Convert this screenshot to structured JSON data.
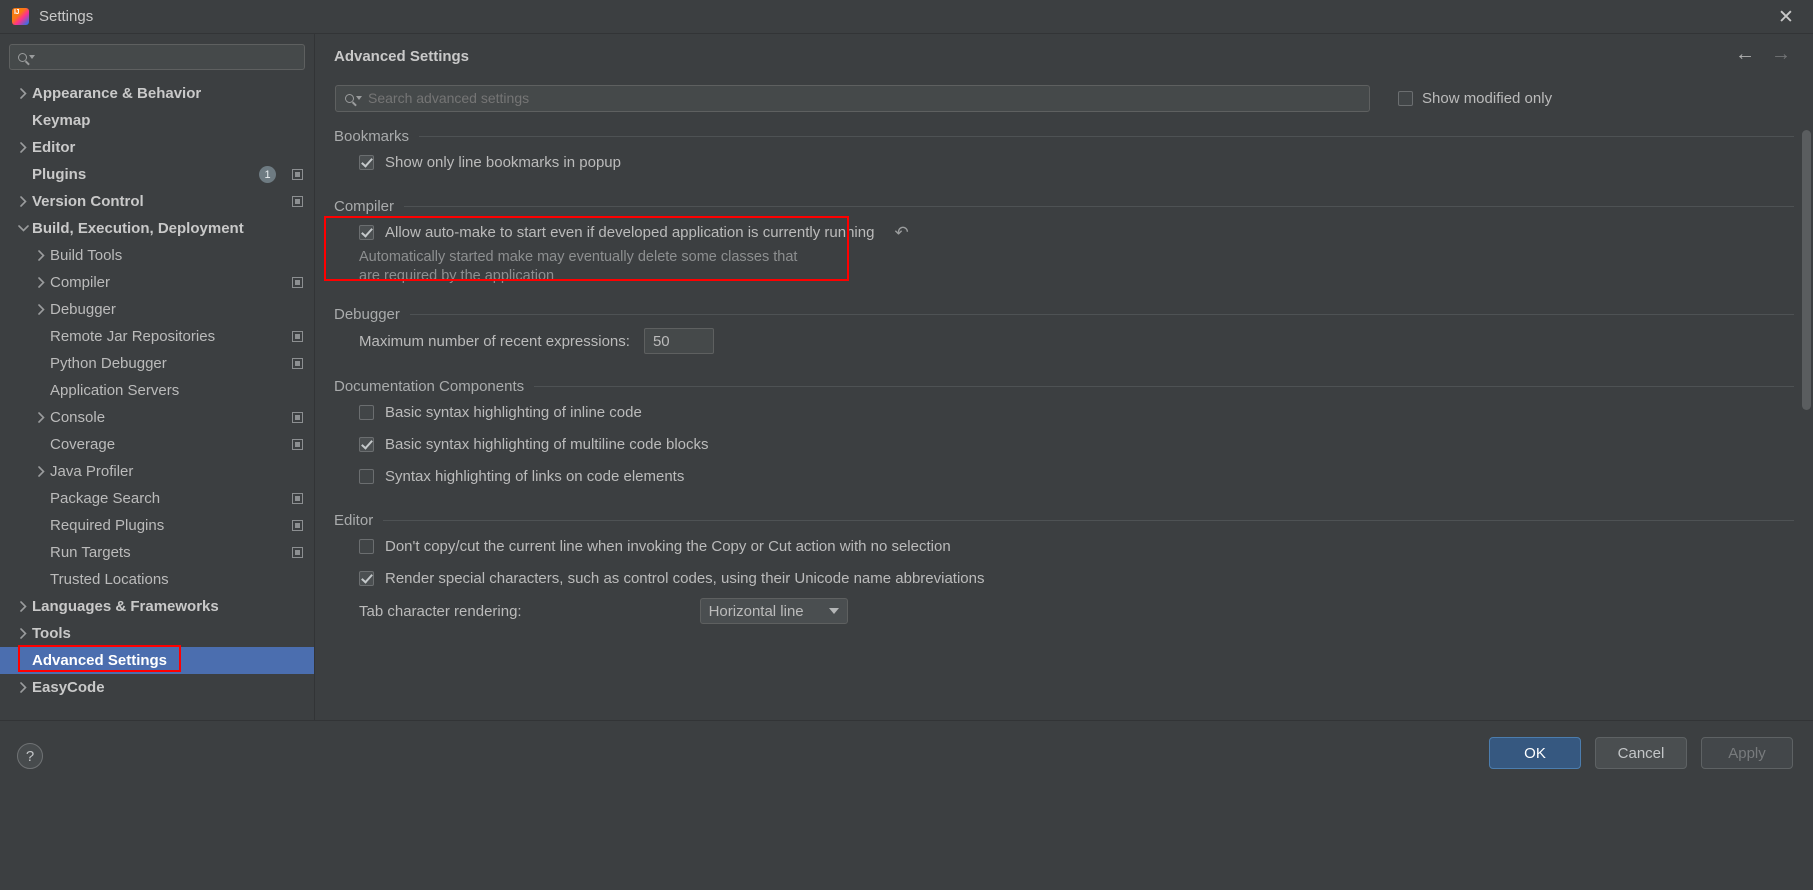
{
  "window": {
    "title": "Settings",
    "app_icon": "intellij-idea-icon",
    "close_label": "✕"
  },
  "sidebar": {
    "search": {
      "value": "",
      "placeholder": ""
    },
    "items": [
      {
        "label": "Appearance & Behavior",
        "chevron": "right",
        "indent": 0,
        "bold": true,
        "badge": null,
        "indicator": false,
        "selected": false
      },
      {
        "label": "Keymap",
        "chevron": "none",
        "indent": 0,
        "bold": true,
        "badge": null,
        "indicator": false,
        "selected": false
      },
      {
        "label": "Editor",
        "chevron": "right",
        "indent": 0,
        "bold": true,
        "badge": null,
        "indicator": false,
        "selected": false
      },
      {
        "label": "Plugins",
        "chevron": "none",
        "indent": 0,
        "bold": true,
        "badge": "1",
        "indicator": true,
        "selected": false
      },
      {
        "label": "Version Control",
        "chevron": "right",
        "indent": 0,
        "bold": true,
        "badge": null,
        "indicator": true,
        "selected": false
      },
      {
        "label": "Build, Execution, Deployment",
        "chevron": "down",
        "indent": 0,
        "bold": true,
        "badge": null,
        "indicator": false,
        "selected": false
      },
      {
        "label": "Build Tools",
        "chevron": "right",
        "indent": 1,
        "bold": false,
        "badge": null,
        "indicator": false,
        "selected": false
      },
      {
        "label": "Compiler",
        "chevron": "right",
        "indent": 1,
        "bold": false,
        "badge": null,
        "indicator": true,
        "selected": false
      },
      {
        "label": "Debugger",
        "chevron": "right",
        "indent": 1,
        "bold": false,
        "badge": null,
        "indicator": false,
        "selected": false
      },
      {
        "label": "Remote Jar Repositories",
        "chevron": "none",
        "indent": 1,
        "bold": false,
        "badge": null,
        "indicator": true,
        "selected": false
      },
      {
        "label": "Python Debugger",
        "chevron": "none",
        "indent": 1,
        "bold": false,
        "badge": null,
        "indicator": true,
        "selected": false
      },
      {
        "label": "Application Servers",
        "chevron": "none",
        "indent": 1,
        "bold": false,
        "badge": null,
        "indicator": false,
        "selected": false
      },
      {
        "label": "Console",
        "chevron": "right",
        "indent": 1,
        "bold": false,
        "badge": null,
        "indicator": true,
        "selected": false
      },
      {
        "label": "Coverage",
        "chevron": "none",
        "indent": 1,
        "bold": false,
        "badge": null,
        "indicator": true,
        "selected": false
      },
      {
        "label": "Java Profiler",
        "chevron": "right",
        "indent": 1,
        "bold": false,
        "badge": null,
        "indicator": false,
        "selected": false
      },
      {
        "label": "Package Search",
        "chevron": "none",
        "indent": 1,
        "bold": false,
        "badge": null,
        "indicator": true,
        "selected": false
      },
      {
        "label": "Required Plugins",
        "chevron": "none",
        "indent": 1,
        "bold": false,
        "badge": null,
        "indicator": true,
        "selected": false
      },
      {
        "label": "Run Targets",
        "chevron": "none",
        "indent": 1,
        "bold": false,
        "badge": null,
        "indicator": true,
        "selected": false
      },
      {
        "label": "Trusted Locations",
        "chevron": "none",
        "indent": 1,
        "bold": false,
        "badge": null,
        "indicator": false,
        "selected": false
      },
      {
        "label": "Languages & Frameworks",
        "chevron": "right",
        "indent": 0,
        "bold": true,
        "badge": null,
        "indicator": false,
        "selected": false
      },
      {
        "label": "Tools",
        "chevron": "right",
        "indent": 0,
        "bold": true,
        "badge": null,
        "indicator": false,
        "selected": false
      },
      {
        "label": "Advanced Settings",
        "chevron": "none",
        "indent": 0,
        "bold": true,
        "badge": null,
        "indicator": false,
        "selected": true
      },
      {
        "label": "EasyCode",
        "chevron": "right",
        "indent": 0,
        "bold": true,
        "badge": null,
        "indicator": false,
        "selected": false
      }
    ]
  },
  "main": {
    "title": "Advanced Settings",
    "nav": {
      "back": "←",
      "forward": "→"
    },
    "search": {
      "value": "",
      "placeholder": "Search advanced settings"
    },
    "show_modified_only": {
      "label": "Show modified only",
      "checked": false
    },
    "sections": [
      {
        "title": "Bookmarks",
        "options": [
          {
            "label": "Show only line bookmarks in popup",
            "checked": true,
            "desc": null,
            "revert": false
          }
        ]
      },
      {
        "title": "Compiler",
        "options": [
          {
            "label": "Allow auto-make to start even if developed application is currently running",
            "checked": true,
            "desc": "Automatically started make may eventually delete some classes that\nare required by the application",
            "revert": true,
            "revert_icon": "revert-arrow-icon"
          }
        ]
      },
      {
        "title": "Debugger",
        "field": {
          "label": "Maximum number of recent expressions:",
          "value": "50"
        }
      },
      {
        "title": "Documentation Components",
        "options": [
          {
            "label": "Basic syntax highlighting of inline code",
            "checked": false,
            "desc": null,
            "revert": false
          },
          {
            "label": "Basic syntax highlighting of multiline code blocks",
            "checked": true,
            "desc": null,
            "revert": false
          },
          {
            "label": "Syntax highlighting of links on code elements",
            "checked": false,
            "desc": null,
            "revert": false
          }
        ]
      },
      {
        "title": "Editor",
        "options": [
          {
            "label": "Don't copy/cut the current line when invoking the Copy or Cut action with no selection",
            "checked": false,
            "desc": null,
            "revert": false
          },
          {
            "label": "Render special characters, such as control codes, using their Unicode name abbreviations",
            "checked": true,
            "desc": null,
            "revert": false
          }
        ],
        "dropdown": {
          "label": "Tab character rendering:",
          "value": "Horizontal line"
        }
      }
    ]
  },
  "footer": {
    "help": "?",
    "ok": "OK",
    "cancel": "Cancel",
    "apply": "Apply"
  },
  "colors": {
    "accent": "#4b6eaf",
    "primary_button": "#365880",
    "annotation": "#ff0000",
    "background": "#3c3f41"
  }
}
